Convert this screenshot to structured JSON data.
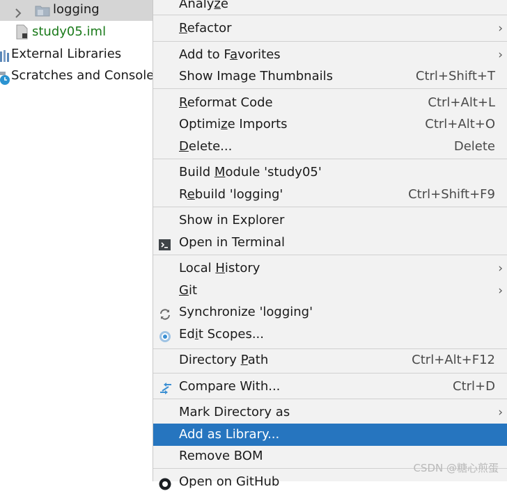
{
  "tree": {
    "items": [
      {
        "label": "logging",
        "icon": "folder-icon",
        "selected": true
      },
      {
        "label": "study05.iml",
        "icon": "iml-file-icon",
        "color": "#1a7a1a"
      },
      {
        "label": "External Libraries",
        "icon": "library-icon"
      },
      {
        "label": "Scratches and Consoles",
        "icon": "scratches-icon"
      }
    ]
  },
  "menu": {
    "items": [
      {
        "label": "Analyze",
        "mnemonic": "z",
        "submenu": false
      },
      {
        "label": "Refactor",
        "mnemonic": "R",
        "submenu": true
      },
      {
        "label": "Add to Favorites",
        "mnemonic": "a",
        "submenu": true
      },
      {
        "label": "Show Image Thumbnails",
        "shortcut": "Ctrl+Shift+T"
      },
      {
        "label": "Reformat Code",
        "mnemonic": "R",
        "shortcut": "Ctrl+Alt+L"
      },
      {
        "label": "Optimize Imports",
        "mnemonic": "z",
        "shortcut": "Ctrl+Alt+O"
      },
      {
        "label": "Delete...",
        "mnemonic": "D",
        "shortcut": "Delete"
      },
      {
        "label": "Build Module 'study05'",
        "mnemonic": "M"
      },
      {
        "label": "Rebuild 'logging'",
        "mnemonic": "e",
        "shortcut": "Ctrl+Shift+F9"
      },
      {
        "label": "Show in Explorer"
      },
      {
        "label": "Open in Terminal",
        "icon": "terminal-icon"
      },
      {
        "label": "Local History",
        "mnemonic": "H",
        "submenu": true
      },
      {
        "label": "Git",
        "mnemonic": "G",
        "submenu": true
      },
      {
        "label": "Synchronize 'logging'",
        "icon": "sync-icon"
      },
      {
        "label": "Edit Scopes...",
        "mnemonic": "i",
        "icon": "scopes-icon"
      },
      {
        "label": "Directory Path",
        "mnemonic": "P",
        "shortcut": "Ctrl+Alt+F12"
      },
      {
        "label": "Compare With...",
        "icon": "compare-icon",
        "shortcut": "Ctrl+D"
      },
      {
        "label": "Mark Directory as",
        "submenu": true
      },
      {
        "label": "Add as Library...",
        "highlighted": true
      },
      {
        "label": "Remove BOM"
      },
      {
        "label": "Open on GitHub",
        "icon": "github-icon"
      }
    ],
    "submenu_arrow": "›"
  },
  "colors": {
    "menu_bg": "#f2f2f2",
    "highlight": "#2675bf",
    "separator": "#d0d0d0",
    "selected_tree_row": "#d5d5d5"
  },
  "watermark": "CSDN @糖心煎蛋"
}
